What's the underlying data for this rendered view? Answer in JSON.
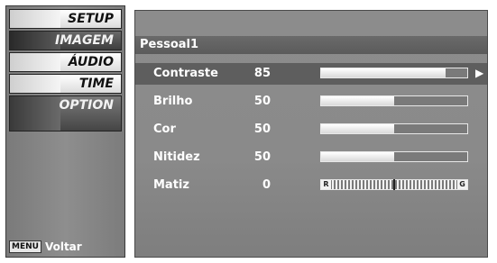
{
  "left_menu": {
    "items": [
      {
        "label": "SETUP",
        "icon": "setup-icon"
      },
      {
        "label": "IMAGEM",
        "icon": "picture-icon"
      },
      {
        "label": "ÁUDIO",
        "icon": "audio-icon"
      },
      {
        "label": "TIME",
        "icon": "time-icon"
      },
      {
        "label": "OPTION",
        "icon": "option-icon"
      }
    ],
    "menu_key": "MENU",
    "back_label": "Voltar"
  },
  "panel": {
    "title": "Pessoal1",
    "rows": [
      {
        "label": "Contraste",
        "value": "85",
        "level": 0.85,
        "selected": true
      },
      {
        "label": "Brilho",
        "value": "50",
        "level": 0.5
      },
      {
        "label": "Cor",
        "value": "50",
        "level": 0.5
      },
      {
        "label": "Nitidez",
        "value": "50",
        "level": 0.5
      },
      {
        "label": "Matiz",
        "value": "0",
        "tint_left": "R",
        "tint_right": "G"
      }
    ]
  }
}
